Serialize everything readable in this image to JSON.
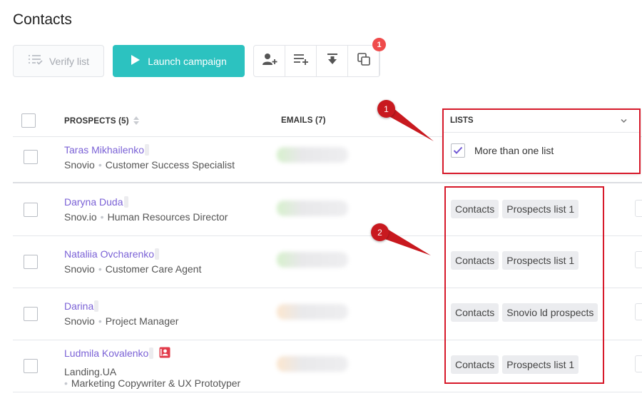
{
  "page": {
    "title": "Contacts"
  },
  "toolbar": {
    "verify_label": "Verify list",
    "launch_label": "Launch campaign",
    "badge_count": "1",
    "icons": [
      "add-contact-icon",
      "add-to-list-icon",
      "download-icon",
      "copy-icon"
    ]
  },
  "table": {
    "headers": {
      "prospects": "PROSPECTS (5)",
      "emails": "EMAILS (7)",
      "lists": "LISTS"
    },
    "rows": [
      {
        "name": "Taras Mikhailenko",
        "company": "Snovio",
        "position": "Customer Success Specialist",
        "email_color": "green",
        "lists": []
      },
      {
        "name": "Daryna Duda",
        "company": "Snov.io",
        "position": "Human Resources Director",
        "email_color": "green",
        "lists": [
          "Contacts",
          "Prospects list 1"
        ]
      },
      {
        "name": "Nataliia Ovcharenko",
        "company": "Snovio",
        "position": "Customer Care Agent",
        "email_color": "green",
        "lists": [
          "Contacts",
          "Prospects list 1"
        ]
      },
      {
        "name": "Darina",
        "company": "Snovio",
        "position": "Project Manager",
        "email_color": "orange",
        "lists": [
          "Contacts",
          "Snovio ld prospects"
        ]
      },
      {
        "name": "Ludmila Kovalenko",
        "company": "Landing.UA",
        "position": "Marketing Copywriter & UX Prototyper",
        "email_color": "orange",
        "lists": [
          "Contacts",
          "Prospects list 1"
        ]
      }
    ]
  },
  "lists_filter": {
    "option": "More than one list",
    "checked": true
  },
  "annotations": {
    "callout_1": "1",
    "callout_2": "2"
  },
  "colors": {
    "accent": "#2cc2c0",
    "link": "#7b62d6",
    "badge": "#ef4b4b",
    "annotation": "#d7192a"
  }
}
